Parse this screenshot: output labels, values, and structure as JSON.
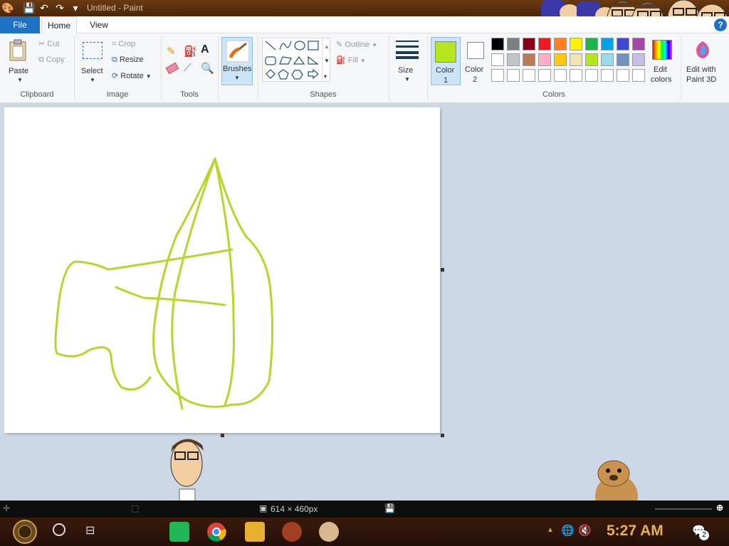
{
  "window": {
    "title": "Untitled - Paint"
  },
  "tabs": {
    "file": "File",
    "home": "Home",
    "view": "View"
  },
  "clipboard": {
    "paste": "Paste",
    "cut": "Cut",
    "copy": "Copy",
    "group": "Clipboard"
  },
  "image": {
    "select": "Select",
    "crop": "Crop",
    "resize": "Resize",
    "rotate": "Rotate",
    "group": "Image"
  },
  "tools": {
    "group": "Tools"
  },
  "brushes": {
    "label": "Brushes"
  },
  "shapes": {
    "outline": "Outline",
    "fill": "Fill",
    "group": "Shapes"
  },
  "size": {
    "label": "Size"
  },
  "colors": {
    "color1_line1": "Color",
    "color1_line2": "1",
    "color2_line1": "Color",
    "color2_line2": "2",
    "edit_line1": "Edit",
    "edit_line2": "colors",
    "paint3d_line1": "Edit with",
    "paint3d_line2": "Paint 3D",
    "group": "Colors",
    "color1_value": "#b5e61d",
    "color2_value": "#ffffff",
    "palette_row1": [
      "#000000",
      "#7f7f7f",
      "#880015",
      "#ed1c24",
      "#ff7f27",
      "#fff200",
      "#22b14c",
      "#00a2e8",
      "#3f48cc",
      "#a349a4"
    ],
    "palette_row2": [
      "#ffffff",
      "#c3c3c3",
      "#b97a57",
      "#ffaec9",
      "#ffc90e",
      "#efe4b0",
      "#b5e61d",
      "#99d9ea",
      "#7092be",
      "#c8bfe7"
    ],
    "palette_row3": [
      "#ffffff",
      "#ffffff",
      "#ffffff",
      "#ffffff",
      "#ffffff",
      "#ffffff",
      "#ffffff",
      "#ffffff",
      "#ffffff",
      "#ffffff"
    ]
  },
  "status": {
    "dimensions": "614 × 460px"
  },
  "taskbar": {
    "clock": "5:27 AM",
    "notification_count": "2"
  }
}
